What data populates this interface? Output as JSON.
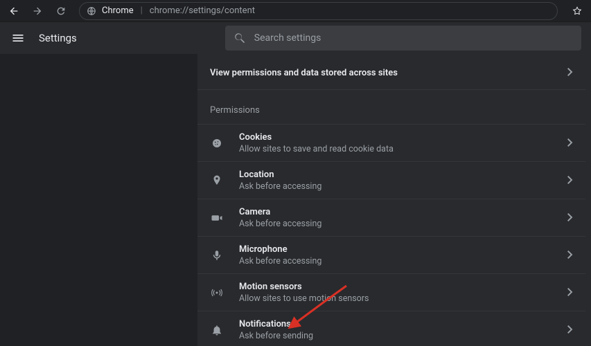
{
  "toolbar": {
    "chrome_label": "Chrome",
    "url_rest": "chrome://settings/content"
  },
  "header": {
    "title": "Settings",
    "search_placeholder": "Search settings"
  },
  "subpage": {
    "link_text": "View permissions and data stored across sites"
  },
  "section_heading": "Permissions",
  "permissions": [
    {
      "title": "Cookies",
      "sub": "Allow sites to save and read cookie data"
    },
    {
      "title": "Location",
      "sub": "Ask before accessing"
    },
    {
      "title": "Camera",
      "sub": "Ask before accessing"
    },
    {
      "title": "Microphone",
      "sub": "Ask before accessing"
    },
    {
      "title": "Motion sensors",
      "sub": "Allow sites to use motion sensors"
    },
    {
      "title": "Notifications",
      "sub": "Ask before sending"
    }
  ]
}
